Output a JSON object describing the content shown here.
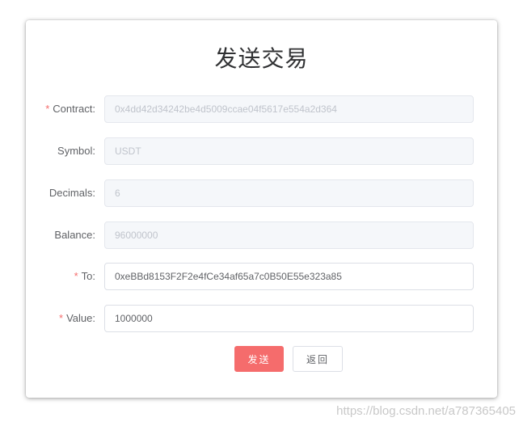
{
  "dialog": {
    "title": "发送交易"
  },
  "form": {
    "contract": {
      "required_mark": "*",
      "label": "Contract:",
      "value": "0x4dd42d34242be4d5009ccae04f5617e554a2d364"
    },
    "symbol": {
      "label": "Symbol:",
      "value": "USDT"
    },
    "decimals": {
      "label": "Decimals:",
      "value": "6"
    },
    "balance": {
      "label": "Balance:",
      "value": "96000000"
    },
    "to": {
      "required_mark": "*",
      "label": "To:",
      "value": "0xeBBd8153F2F2e4fCe34af65a7c0B50E55e323a85"
    },
    "amount": {
      "required_mark": "*",
      "label": "Value:",
      "value": "1000000"
    }
  },
  "buttons": {
    "send": "发送",
    "back": "返回"
  },
  "watermark": "https://blog.csdn.net/a787365405",
  "colors": {
    "primary_danger": "#f56c6c",
    "required_mark": "#f56c6c",
    "label_text": "#606266",
    "disabled_bg": "#f5f7fa",
    "disabled_text": "#c0c4cc"
  }
}
